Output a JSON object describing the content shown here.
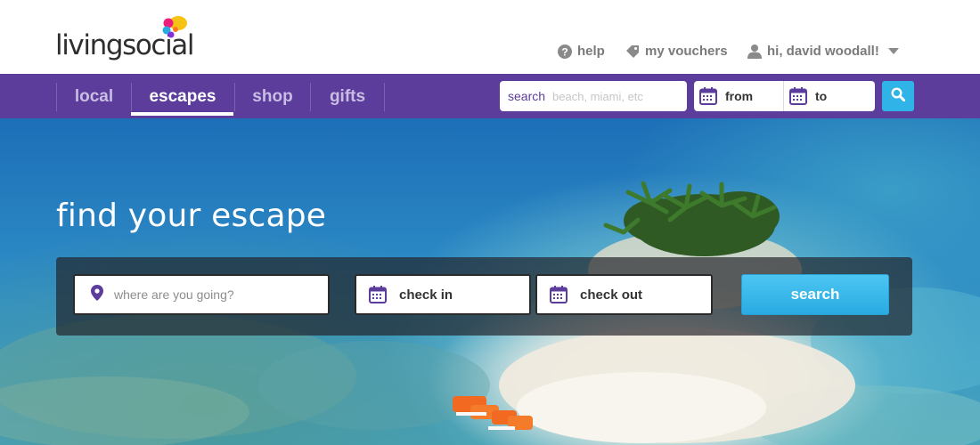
{
  "brand": {
    "name": "livingsocial",
    "logo_colors": [
      "#f6c315",
      "#ec1d7b",
      "#29abe2",
      "#8a2be2"
    ]
  },
  "colors": {
    "nav_bg": "#5d3d9b",
    "accent": "#29abe2",
    "nav_inactive": "#c9bde3"
  },
  "header": {
    "help_label": "help",
    "vouchers_label": "my vouchers",
    "user_greeting": "hi, david woodall!"
  },
  "nav": {
    "tabs": [
      {
        "label": "local",
        "active": false
      },
      {
        "label": "escapes",
        "active": true
      },
      {
        "label": "shop",
        "active": false
      },
      {
        "label": "gifts",
        "active": false
      }
    ],
    "search": {
      "label": "search",
      "placeholder": "beach, miami, etc",
      "value": ""
    },
    "dates": {
      "from_label": "from",
      "to_label": "to"
    },
    "search_button_icon": "magnifier-icon"
  },
  "hero": {
    "title": "find your escape",
    "form": {
      "where_placeholder": "where are you going?",
      "where_value": "",
      "checkin_label": "check in",
      "checkout_label": "check out",
      "search_label": "search"
    }
  }
}
